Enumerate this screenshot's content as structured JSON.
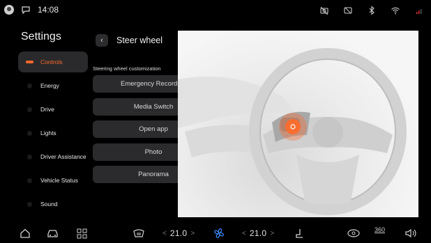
{
  "status_bar": {
    "time": "14:08",
    "icons": [
      "user-avatar-icon",
      "message-icon",
      "camera-off-icon",
      "screen-icon",
      "bluetooth-icon",
      "wifi-icon",
      "signal-icon"
    ]
  },
  "settings_title": "Settings",
  "sidebar": {
    "items": [
      {
        "label": "Controls",
        "icon": "car-icon",
        "active": true
      },
      {
        "label": "Energy",
        "icon": "energy-icon",
        "active": false
      },
      {
        "label": "Drive",
        "icon": "drive-icon",
        "active": false
      },
      {
        "label": "Lights",
        "icon": "lights-icon",
        "active": false
      },
      {
        "label": "Driver Assistance",
        "icon": "driver-assistance-icon",
        "active": false
      },
      {
        "label": "Vehicle Status",
        "icon": "vehicle-status-icon",
        "active": false
      },
      {
        "label": "Sound",
        "icon": "sound-icon",
        "active": false
      }
    ]
  },
  "page": {
    "back_glyph": "‹",
    "title": "Steer wheel",
    "section_label": "Steering wheel customization",
    "options": [
      "Emergency Recording",
      "Media Switch",
      "Open app",
      "Photo",
      "Panorama"
    ]
  },
  "dock": {
    "left_temp": "21.0",
    "right_temp": "21.0",
    "left_arrow_l": "<",
    "left_arrow_r": ">",
    "right_arrow_l": "<",
    "right_arrow_r": ">",
    "camera_label": "360",
    "icons": [
      "home-icon",
      "car-icon",
      "apps-grid-icon",
      "windshield-defrost-icon",
      "fan-icon",
      "seat-icon",
      "steering-wheel-heat-icon",
      "camera-360-icon",
      "volume-icon"
    ]
  },
  "colors": {
    "accent": "#ff6a2a",
    "fan": "#3c8cff",
    "background": "#000000",
    "button": "#2b2b2d"
  }
}
